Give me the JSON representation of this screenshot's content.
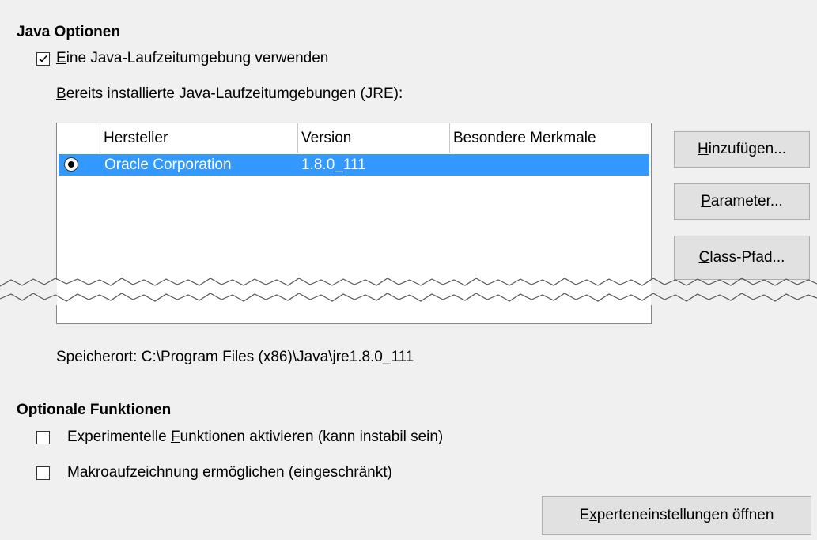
{
  "java_section": {
    "title": "Java Optionen",
    "use_jre": {
      "label": "Eine Java-Laufzeitumgebung verwenden",
      "mnemonic": "E",
      "rest": "ine Java-Laufzeitumgebung verwenden",
      "checked": true
    },
    "installed_label": {
      "mnemonic": "B",
      "rest": "ereits installierte Java-Laufzeitumgebungen (JRE):"
    },
    "table": {
      "columns": [
        "",
        "Hersteller",
        "Version",
        "Besondere Merkmale"
      ],
      "rows": [
        {
          "vendor": "Oracle Corporation",
          "version": "1.8.0_111",
          "features": "",
          "selected": true
        }
      ]
    },
    "buttons": {
      "add": {
        "mnemonic": "H",
        "rest": "inzufügen..."
      },
      "params": {
        "mnemonic": "P",
        "rest": "arameter..."
      },
      "classpath": {
        "mnemonic": "C",
        "rest": "lass-Pfad..."
      }
    },
    "location": "Speicherort: C:\\Program Files (x86)\\Java\\jre1.8.0_111"
  },
  "optional_section": {
    "title": "Optionale Funktionen",
    "experimental": {
      "before": "Experimentelle ",
      "mnemonic": "F",
      "rest": "unktionen aktivieren (kann instabil sein)",
      "checked": false
    },
    "macro": {
      "mnemonic": "M",
      "rest": "akroaufzeichnung ermöglichen (eingeschränkt)",
      "checked": false
    }
  },
  "expert_button": {
    "before": "E",
    "mnemonic": "x",
    "rest": "perteneinstellungen öffnen"
  }
}
